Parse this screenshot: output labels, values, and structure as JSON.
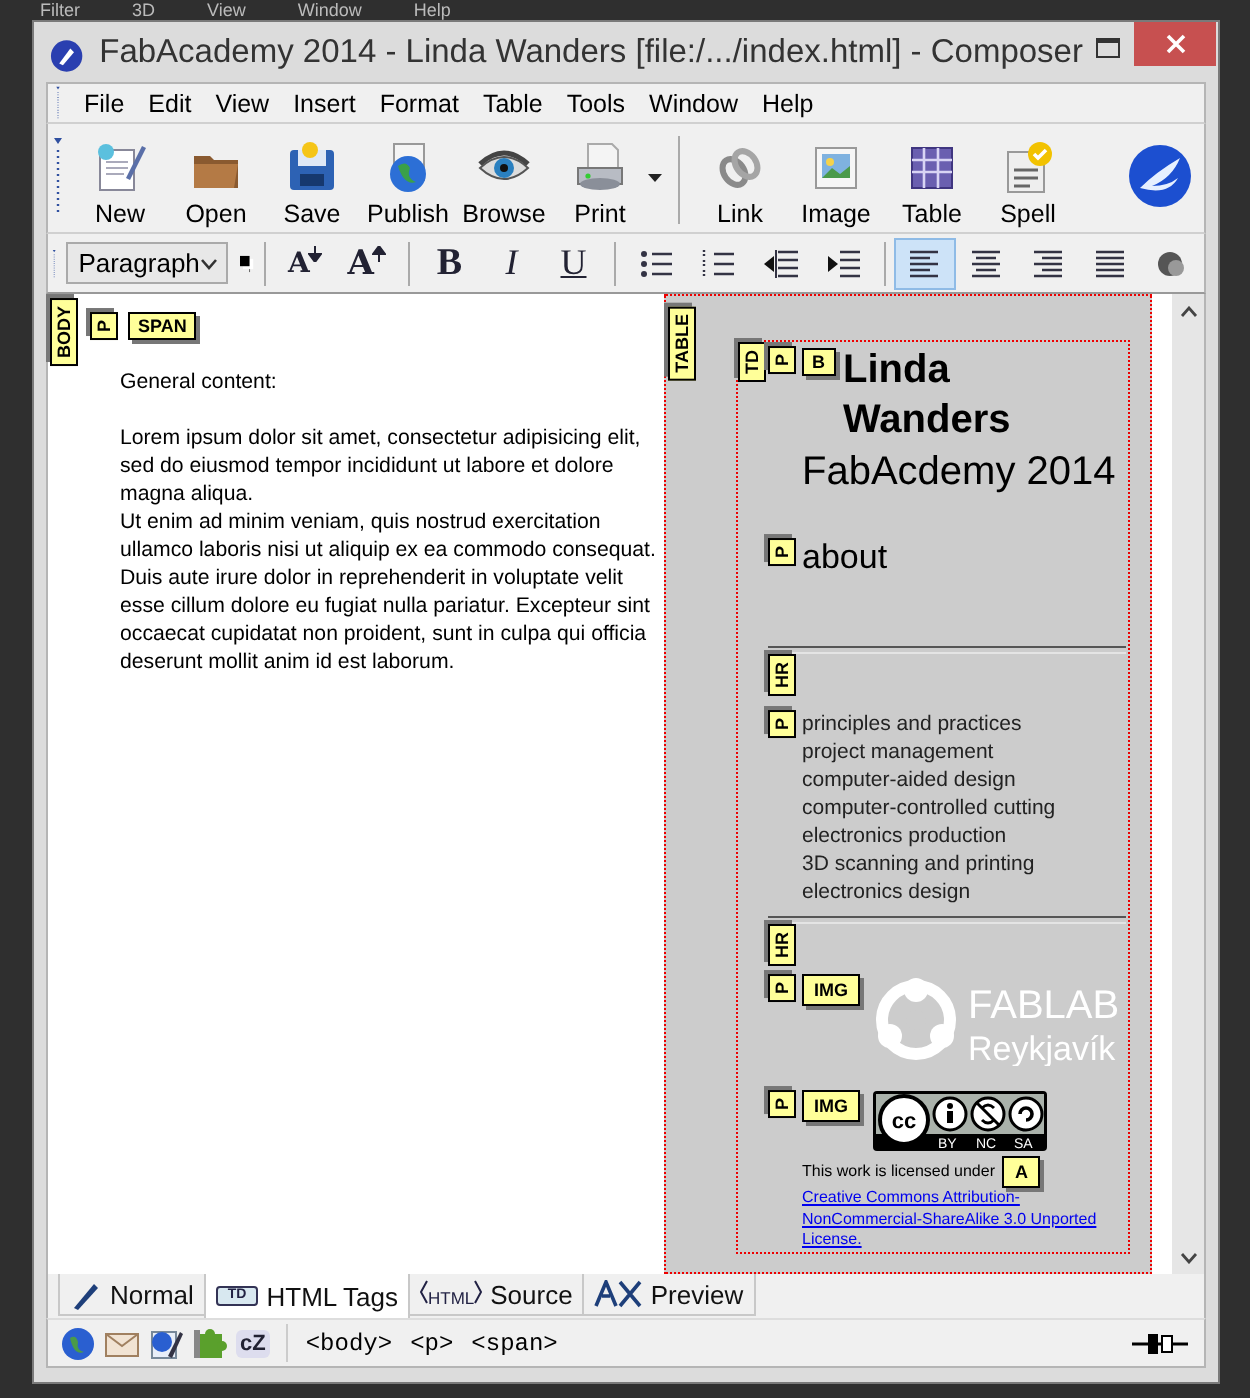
{
  "background_app": {
    "menu": [
      "Filter",
      "3D",
      "View",
      "Window",
      "Help"
    ]
  },
  "window": {
    "title": "FabAcademy 2014 - Linda Wanders [file:/.../index.html] - Composer"
  },
  "menu": [
    {
      "label": "File"
    },
    {
      "label": "Edit"
    },
    {
      "label": "View"
    },
    {
      "label": "Insert"
    },
    {
      "label": "Format"
    },
    {
      "label": "Table"
    },
    {
      "label": "Tools"
    },
    {
      "label": "Window"
    },
    {
      "label": "Help"
    }
  ],
  "toolbar": {
    "groups": [
      [
        {
          "kind": "new",
          "label": "New",
          "dropdown": false
        },
        {
          "kind": "open",
          "label": "Open",
          "dropdown": false
        },
        {
          "kind": "save",
          "label": "Save",
          "dropdown": false
        },
        {
          "kind": "publish",
          "label": "Publish",
          "dropdown": false
        },
        {
          "kind": "browse",
          "label": "Browse",
          "dropdown": false
        },
        {
          "kind": "print",
          "label": "Print",
          "dropdown": true
        }
      ],
      [
        {
          "kind": "link",
          "label": "Link",
          "dropdown": false
        },
        {
          "kind": "image",
          "label": "Image",
          "dropdown": false
        },
        {
          "kind": "table",
          "label": "Table",
          "dropdown": false
        },
        {
          "kind": "spell",
          "label": "Spell",
          "dropdown": false
        }
      ]
    ]
  },
  "format_toolbar": {
    "paragraph_style": "Paragraph",
    "button_groups": [
      [
        {
          "kind": "font-smaller",
          "glyph": "A",
          "selected": false
        },
        {
          "kind": "font-larger",
          "glyph": "A",
          "selected": false
        }
      ],
      [
        {
          "kind": "bold",
          "glyph": "B",
          "selected": false
        },
        {
          "kind": "italic",
          "glyph": "I",
          "selected": false
        },
        {
          "kind": "underline",
          "glyph": "U",
          "selected": false
        }
      ],
      [
        {
          "kind": "bullets",
          "selected": false
        },
        {
          "kind": "numbers",
          "selected": false
        },
        {
          "kind": "outdent",
          "selected": false
        },
        {
          "kind": "indent",
          "selected": false
        }
      ],
      [
        {
          "kind": "align-left",
          "selected": true
        },
        {
          "kind": "align-center",
          "selected": false
        },
        {
          "kind": "align-right",
          "selected": false
        },
        {
          "kind": "justify",
          "selected": false
        },
        {
          "kind": "more",
          "selected": false
        }
      ]
    ]
  },
  "left_pane": {
    "body_tag": "BODY",
    "inline_tags": [
      "P",
      "SPAN"
    ],
    "heading": "General content:",
    "paragraphs": [
      "Lorem ipsum dolor sit amet, consectetur adipisicing elit, sed do eiusmod tempor incididunt ut labore et dolore magna aliqua.",
      "Ut enim ad minim veniam, quis nostrud exercitation ullamco laboris nisi ut aliquip ex ea commodo consequat. Duis aute irure dolor in reprehenderit in voluptate velit esse cillum dolore eu fugiat nulla pariatur. Excepteur sint occaecat cupidatat non proident, sunt in culpa qui officia deserunt mollit anim id est laborum."
    ]
  },
  "right_pane": {
    "table_tag": "TABLE",
    "cell_tag": "TD",
    "blocks": [
      {
        "kind": "title",
        "tags": [
          "P",
          "B"
        ],
        "name": "Linda Wanders",
        "subtitle": "FabAcdemy 2014"
      },
      {
        "kind": "paragraph",
        "tags": [
          "P"
        ],
        "text": "about"
      },
      {
        "kind": "rule",
        "tags": [
          "HR"
        ]
      },
      {
        "kind": "list",
        "tags": [
          "P"
        ],
        "lines": [
          "principles and practices",
          "project management",
          "computer-aided design",
          "computer-controlled cutting",
          "electronics production",
          "3D scanning and printing",
          "electronics design"
        ]
      },
      {
        "kind": "rule",
        "tags": [
          "HR"
        ]
      },
      {
        "kind": "logo",
        "tags": [
          "P",
          "IMG"
        ],
        "logo_text": [
          "FAB",
          "LAB",
          "Reykjavík"
        ]
      },
      {
        "kind": "license",
        "tags": [
          "P",
          "IMG"
        ],
        "cc_mark": "cc",
        "badge_labels": [
          "BY",
          "NC",
          "SA"
        ],
        "text": "This work is licensed under",
        "link_tag": "A",
        "link": "Creative Commons Attribution-NonCommercial-ShareAlike 3.0 Unported License."
      }
    ]
  },
  "tabs": [
    {
      "kind": "normal",
      "label": "Normal",
      "selected": false
    },
    {
      "kind": "tags",
      "label": "HTML Tags",
      "icon_text": "TD",
      "selected": true
    },
    {
      "kind": "source",
      "label": "Source",
      "icon_text": "HTML",
      "selected": false
    },
    {
      "kind": "preview",
      "label": "Preview",
      "selected": false
    }
  ],
  "status_bar": {
    "icons": [
      {
        "kind": "globe"
      },
      {
        "kind": "mail"
      },
      {
        "kind": "composer"
      },
      {
        "kind": "addressbook"
      },
      {
        "kind": "chat",
        "glyph": "cZ"
      }
    ],
    "tag_path": [
      "<body>",
      "<p>",
      "<span>"
    ]
  }
}
